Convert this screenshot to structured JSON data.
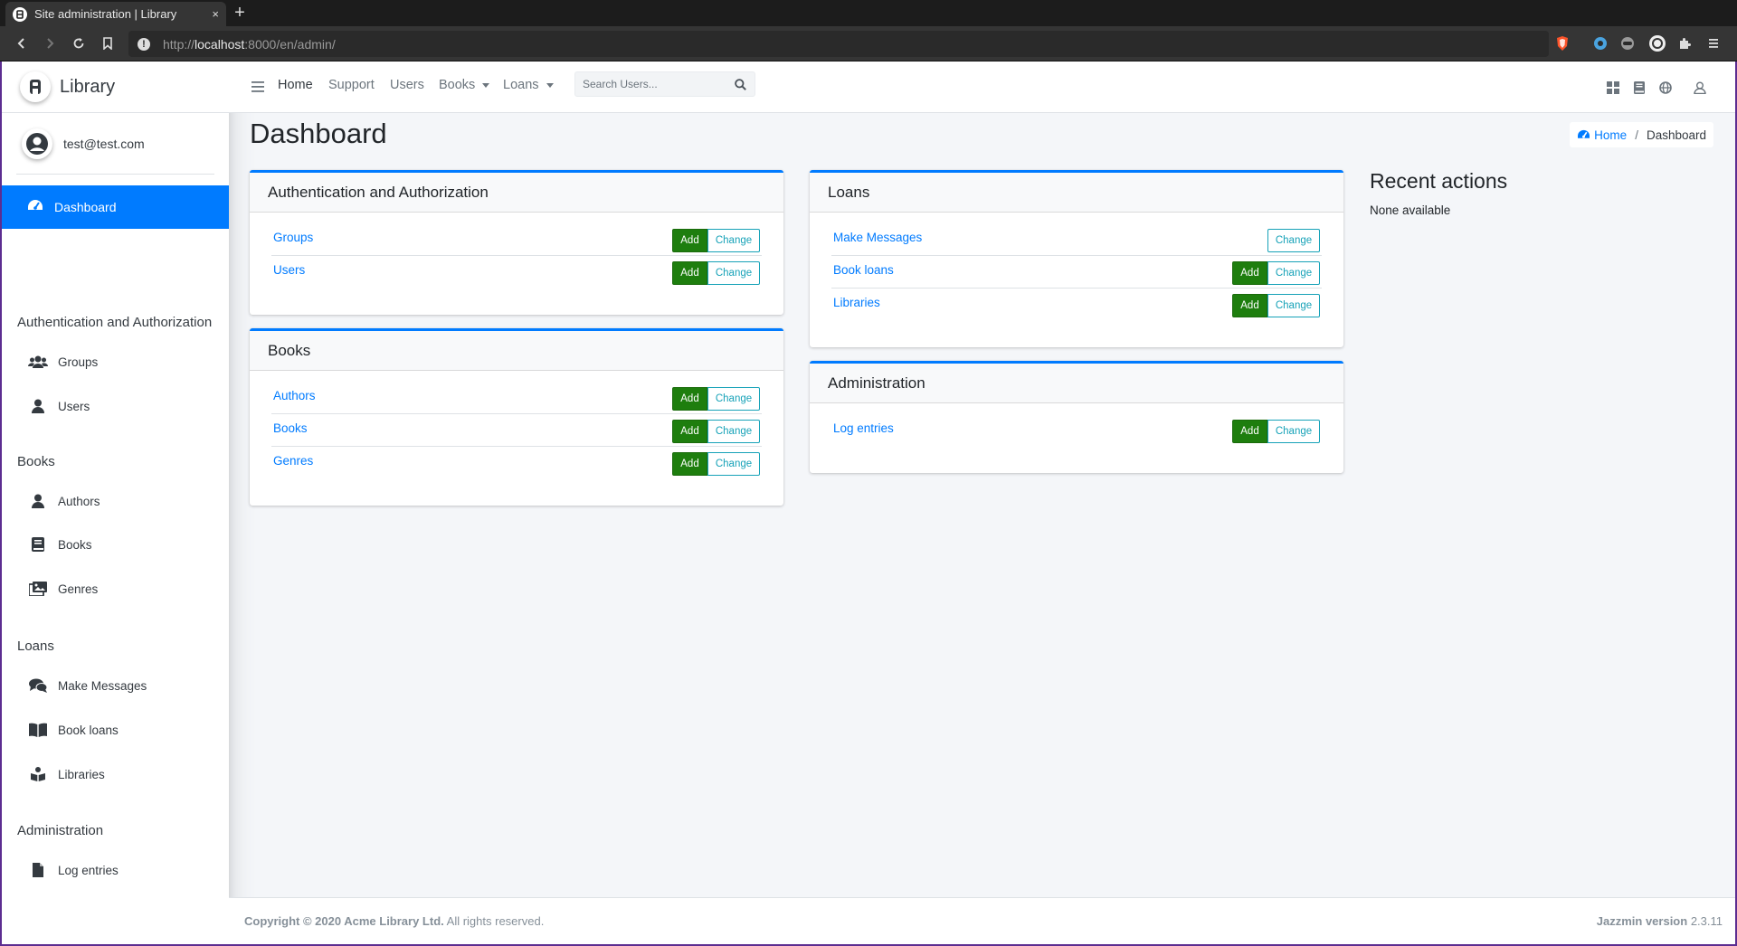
{
  "browser": {
    "tab_title": "Site administration | Library",
    "tab_close": "×",
    "new_tab": "+",
    "url_scheme": "http://",
    "url_host": "localhost",
    "url_rest": ":8000/en/admin/"
  },
  "sidebar": {
    "brand": "Library",
    "user": "test@test.com",
    "active_item": "Dashboard",
    "groups": [
      {
        "header": "Authentication and Authorization",
        "items": [
          "Groups",
          "Users"
        ]
      },
      {
        "header": "Books",
        "items": [
          "Authors",
          "Books",
          "Genres"
        ]
      },
      {
        "header": "Loans",
        "items": [
          "Make Messages",
          "Book loans",
          "Libraries"
        ]
      },
      {
        "header": "Administration",
        "items": [
          "Log entries"
        ]
      }
    ]
  },
  "topnav": {
    "items": [
      "Home",
      "Support",
      "Users",
      "Books",
      "Loans"
    ],
    "search_placeholder": "Search Users..."
  },
  "content": {
    "title": "Dashboard",
    "breadcrumb_home": "Home",
    "breadcrumb_sep": "/",
    "breadcrumb_current": "Dashboard",
    "add_label": "Add",
    "change_label": "Change",
    "apps": [
      {
        "name": "Authentication and Authorization",
        "models": [
          "Groups",
          "Users"
        ]
      },
      {
        "name": "Books",
        "models": [
          "Authors",
          "Books",
          "Genres"
        ]
      },
      {
        "name": "Loans",
        "models": [
          "Make Messages",
          "Book loans",
          "Libraries"
        ]
      },
      {
        "name": "Administration",
        "models": [
          "Log entries"
        ]
      }
    ],
    "recent_title": "Recent actions",
    "recent_empty": "None available"
  },
  "footer": {
    "copyright_bold": "Copyright © 2020 Acme Library Ltd.",
    "copyright_rest": " All rights reserved.",
    "version_label": "Jazzmin version",
    "version": " 2.3.11"
  },
  "colors": {
    "primary": "#007bff",
    "add_button": "#1e7e0e",
    "change_button": "#17a2b8",
    "frame": "#5c2d91"
  }
}
